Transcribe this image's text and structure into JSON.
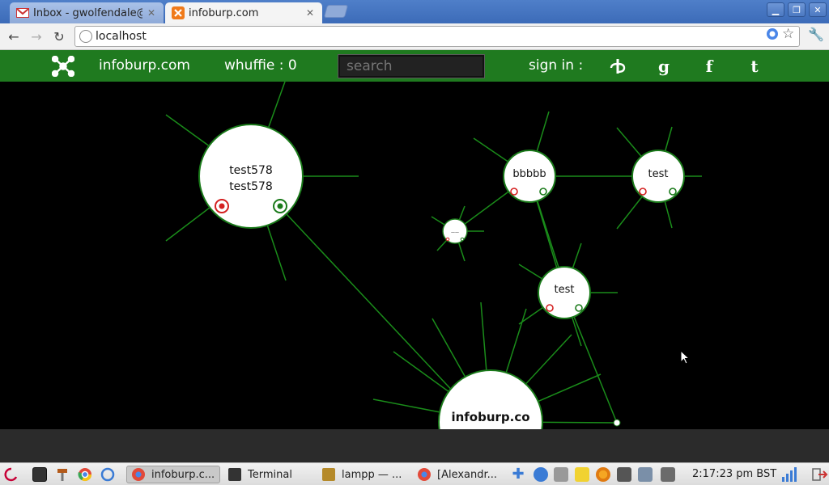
{
  "browser": {
    "tabs": [
      {
        "title": "Inbox - gwolfendale@gr",
        "active": false,
        "icon": "gmail-icon"
      },
      {
        "title": "infoburp.com",
        "active": true,
        "icon": "xampp-icon"
      }
    ],
    "address": "localhost"
  },
  "site": {
    "brand": "infoburp.com",
    "whuffie": "whuffie : 0",
    "search_placeholder": "search",
    "signin": "sign in :",
    "social": [
      {
        "name": "openid-icon",
        "glyph": "ꝺ"
      },
      {
        "name": "google-icon",
        "glyph": "g"
      },
      {
        "name": "facebook-icon",
        "glyph": "f"
      },
      {
        "name": "tumblr-icon",
        "glyph": "t"
      }
    ]
  },
  "graph": {
    "nodes": [
      {
        "id": "n-test578",
        "lines": [
          "test578",
          "test578"
        ]
      },
      {
        "id": "n-bbbbb",
        "lines": [
          "bbbbb"
        ]
      },
      {
        "id": "n-test-a",
        "lines": [
          "test"
        ]
      },
      {
        "id": "n-small",
        "lines": [
          "——"
        ]
      },
      {
        "id": "n-test-b",
        "lines": [
          "test"
        ]
      },
      {
        "id": "n-root",
        "lines": [
          "infoburp.co"
        ]
      }
    ]
  },
  "taskbar": {
    "tasks": [
      {
        "label": "infoburp.c...",
        "active": true,
        "icon": "chrome-icon"
      },
      {
        "label": "Terminal",
        "active": false,
        "icon": "terminal-icon"
      },
      {
        "label": "lampp — ...",
        "active": false,
        "icon": "folder-icon"
      },
      {
        "label": "[Alexandr...",
        "active": false,
        "icon": "chrome-icon"
      }
    ],
    "clock": "2:17:23 pm BST"
  },
  "colors": {
    "header_green": "#1f7a1f",
    "edge_green": "#1a8c1a",
    "node_border": "#1a7a1a",
    "vote_red": "#d42020",
    "vote_green": "#1a7a1a"
  }
}
